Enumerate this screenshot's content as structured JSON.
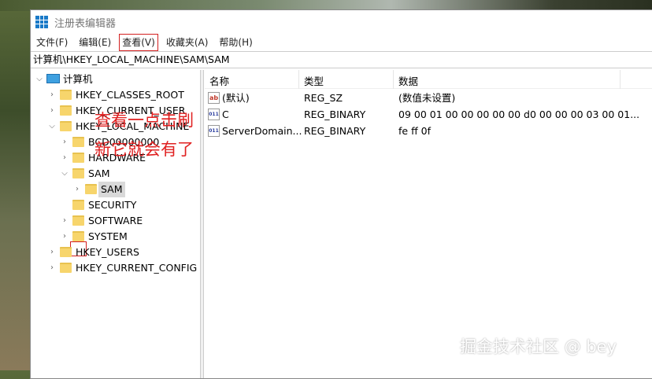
{
  "window": {
    "title": "注册表编辑器"
  },
  "menu": [
    "文件(F)",
    "编辑(E)",
    "查看(V)",
    "收藏夹(A)",
    "帮助(H)"
  ],
  "address": "计算机\\HKEY_LOCAL_MACHINE\\SAM\\SAM",
  "tree": {
    "root": "计算机",
    "items": [
      "HKEY_CLASSES_ROOT",
      "HKEY_CURRENT_USER",
      "HKEY_LOCAL_MACHINE",
      "BCD00000000",
      "HARDWARE",
      "SAM",
      "SAM",
      "SECURITY",
      "SOFTWARE",
      "SYSTEM",
      "HKEY_USERS",
      "HKEY_CURRENT_CONFIG"
    ]
  },
  "list": {
    "headers": [
      "名称",
      "类型",
      "数据"
    ],
    "rows": [
      {
        "name": "(默认)",
        "type": "REG_SZ",
        "data": "(数值未设置)",
        "icon": "string-value-icon"
      },
      {
        "name": "C",
        "type": "REG_BINARY",
        "data": "09 00 01 00 00 00 00 00 d0 00 00 00 03 00 01...",
        "icon": "binary-value-icon"
      },
      {
        "name": "ServerDomain...",
        "type": "REG_BINARY",
        "data": "fe ff 0f",
        "icon": "binary-value-icon"
      }
    ]
  },
  "annotation": {
    "line1": "查看一点击刷",
    "line2": "新它就会有了"
  },
  "watermark": "掘金技术社区 @ bey",
  "colors": {
    "annotation": "#e02020",
    "selection": "#d9d9d9"
  }
}
